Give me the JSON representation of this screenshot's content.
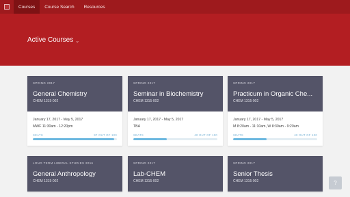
{
  "nav": {
    "items": [
      {
        "label": "Courses",
        "active": true
      },
      {
        "label": "Course Search",
        "active": false
      },
      {
        "label": "Resources",
        "active": false
      }
    ]
  },
  "hero": {
    "title": "Active Courses",
    "chevron": "⌄"
  },
  "courses": [
    {
      "term": "SPRING 2017",
      "name": "General Chemistry",
      "code": "CHEM 1315-002",
      "dates": "January 17, 2017 - May 5, 2017",
      "times": "MWF 11:30am - 12:20pm",
      "seats_label": "SEATS",
      "seats_text": "97 OUT OF 100",
      "seats_fraction": 0.97
    },
    {
      "term": "SPRING 2017",
      "name": "Seminar in Biochemistry",
      "code": "CHEM 1315-002",
      "dates": "January 17, 2017 - May 5, 2017",
      "times": "TBA",
      "seats_label": "SEATS",
      "seats_text": "40 OUT OF 100",
      "seats_fraction": 0.4
    },
    {
      "term": "SPRING 2017",
      "name": "Practicum in Organic Che...",
      "code": "CHEM 1315-002",
      "dates": "January 17, 2017 - May 5, 2017",
      "times": "M 8:20am - 11:10am, W 8:30am - 9:20am",
      "seats_label": "SEATS",
      "seats_text": "40 OUT OF 100",
      "seats_fraction": 0.4
    },
    {
      "term": "LONG TERM LIBERAL STUDIES 2016",
      "name": "General Anthropology",
      "code": "CHEM 1315-002"
    },
    {
      "term": "SPRING 2017",
      "name": "Lab-CHEM",
      "code": "CHEM 1315-002"
    },
    {
      "term": "SPRING 2017",
      "name": "Senior Thesis",
      "code": "CHEM 1315-002"
    }
  ],
  "help": {
    "label": "?"
  },
  "colors": {
    "brand": "#b31e22",
    "card_header": "#545468",
    "progress": "#6cb8e0"
  }
}
